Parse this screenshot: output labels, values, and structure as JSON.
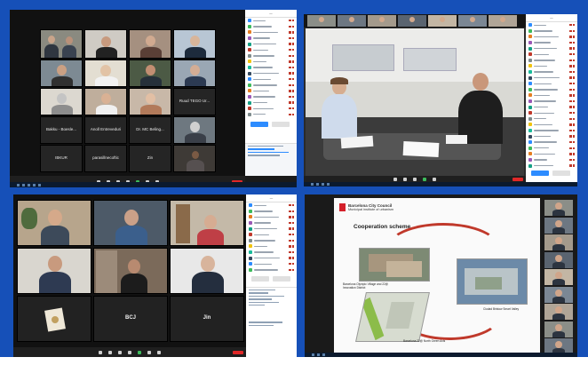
{
  "panels": {
    "top_left": {
      "tiles": [
        {
          "name": ""
        },
        {
          "name": ""
        },
        {
          "name": ""
        },
        {
          "name": ""
        },
        {
          "name": ""
        },
        {
          "name": ""
        },
        {
          "name": ""
        },
        {
          "name": ""
        },
        {
          "name": ""
        },
        {
          "name": ""
        },
        {
          "name": ""
        },
        {
          "name": "Ruud TEGO Ur..."
        },
        {
          "name": "Bakku - Boesle..."
        },
        {
          "name": "Anoll Entreveduri"
        },
        {
          "name": "Dr. MC Beling..."
        },
        {
          "name": ""
        },
        {
          "name": "IBKUR"
        },
        {
          "name": "parasillnecoftic"
        },
        {
          "name": "Zin"
        },
        {
          "name": ""
        }
      ]
    },
    "top_right": {},
    "bottom_left": {
      "tiles": [
        {
          "name": ""
        },
        {
          "name": ""
        },
        {
          "name": ""
        },
        {
          "name": ""
        },
        {
          "name": ""
        },
        {
          "name": ""
        },
        {
          "name": ""
        },
        {
          "name": "BCJ"
        },
        {
          "name": "Jin"
        }
      ]
    },
    "bottom_right": {
      "slide": {
        "org_name": "Barcelona City Council",
        "org_subtitle": "Municipal institute of urbanism",
        "title": "Cooperation scheme",
        "label_left": "Barcelona Olympic Village and 22@ Innovation District",
        "label_right": "Ciudad Bristow Smart Valley",
        "label_bottom": "Barcelona 22@ North Green Axis"
      }
    }
  },
  "colors": {
    "frame_blue": "#1650b8",
    "zoom_dark": "#1a1a1a",
    "end_red": "#e02828",
    "accent_blue": "#2d8cff",
    "slide_red": "#c0392b"
  }
}
